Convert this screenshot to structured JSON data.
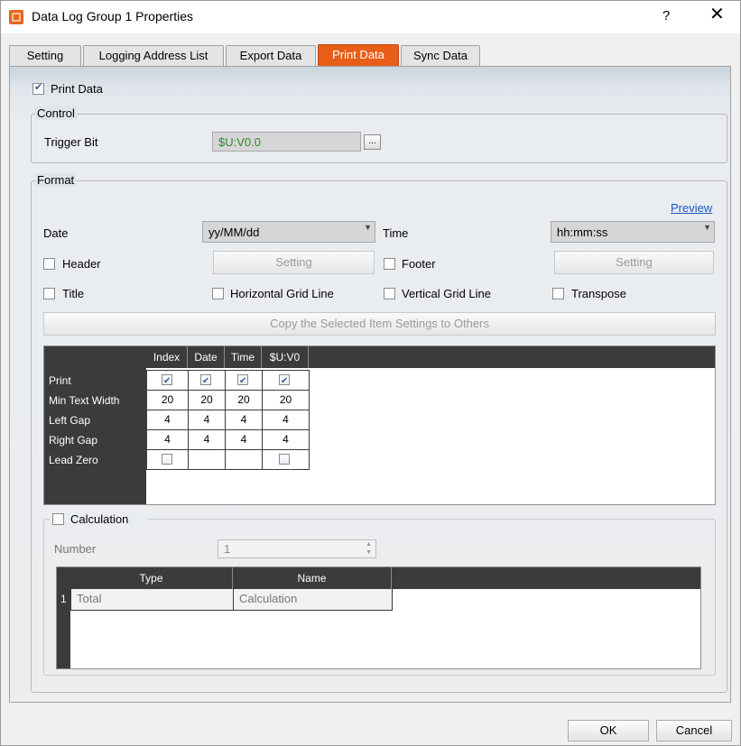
{
  "window": {
    "title": "Data Log Group 1 Properties",
    "help": "?",
    "close": "✕"
  },
  "tabs": [
    {
      "label": "Setting"
    },
    {
      "label": "Logging Address List"
    },
    {
      "label": "Export Data"
    },
    {
      "label": "Print Data"
    },
    {
      "label": "Sync Data"
    }
  ],
  "print_data": {
    "label": "Print Data",
    "checked": true
  },
  "control": {
    "title": "Control",
    "trigger_label": "Trigger Bit",
    "trigger_value": "$U:V0.0",
    "browse": "..."
  },
  "format": {
    "title": "Format",
    "preview": "Preview",
    "date_label": "Date",
    "date_value": "yy/MM/dd",
    "time_label": "Time",
    "time_value": "hh:mm:ss",
    "header_label": "Header",
    "footer_label": "Footer",
    "setting_label": "Setting",
    "title_label": "Title",
    "hgrid_label": "Horizontal Grid Line",
    "vgrid_label": "Vertical  Grid Line",
    "transpose_label": "Transpose",
    "copy_button": "Copy the Selected Item Settings to Others"
  },
  "grid": {
    "columns": [
      "Index",
      "Date",
      "Time",
      "$U:V0"
    ],
    "rows": [
      {
        "label": "Print",
        "cells": [
          "check",
          "check",
          "check",
          "check"
        ]
      },
      {
        "label": "Min Text Width",
        "cells": [
          "20",
          "20",
          "20",
          "20"
        ]
      },
      {
        "label": "Left Gap",
        "cells": [
          "4",
          "4",
          "4",
          "4"
        ]
      },
      {
        "label": "Right Gap",
        "cells": [
          "4",
          "4",
          "4",
          "4"
        ]
      },
      {
        "label": "Lead Zero",
        "cells": [
          "box",
          "",
          "",
          "box"
        ]
      }
    ]
  },
  "calculation": {
    "label": "Calculation",
    "number_label": "Number",
    "number_value": "1",
    "columns": [
      "Type",
      "Name"
    ],
    "rows": [
      {
        "index": "1",
        "type": "Total",
        "name": "Calculation"
      }
    ]
  },
  "footer": {
    "ok": "OK",
    "cancel": "Cancel"
  }
}
